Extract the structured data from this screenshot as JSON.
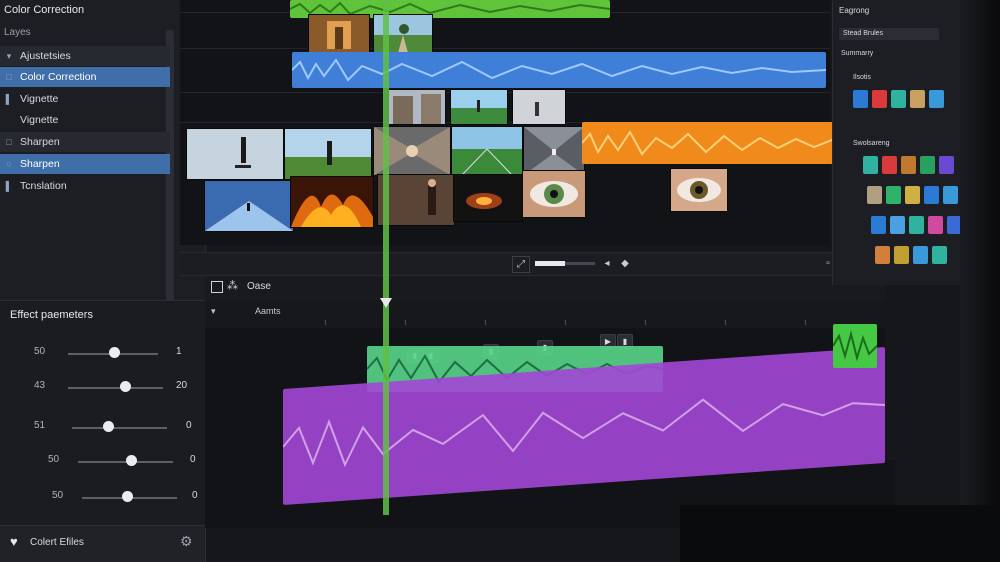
{
  "left_panel": {
    "title": "Color Correction",
    "layer_label": "Layes",
    "items": [
      {
        "label": "Ajustetsies",
        "icon": "collapse-icon",
        "state": "alt"
      },
      {
        "label": "Color Correction",
        "icon": "square-icon",
        "state": "selected"
      },
      {
        "label": "Vignette",
        "icon": "bar-icon",
        "state": "normal"
      },
      {
        "label": "Vignette",
        "icon": "",
        "state": "normal"
      },
      {
        "label": "Sharpen",
        "icon": "square-icon",
        "state": "alt"
      },
      {
        "label": "Sharpen",
        "icon": "circle-icon",
        "state": "selected"
      },
      {
        "label": "Tcnslation",
        "icon": "bar-icon",
        "state": "normal"
      }
    ],
    "effect_parameters": {
      "title": "Effect paemeters",
      "rows": [
        {
          "label": "50",
          "value": "1",
          "level": 0.55
        },
        {
          "label": "43",
          "value": "20",
          "level": 0.62
        },
        {
          "label": "51",
          "value": "0",
          "level": 0.45
        },
        {
          "label": "50",
          "value": "0",
          "level": 0.6
        },
        {
          "label": "50",
          "value": "0",
          "level": 0.55
        }
      ]
    },
    "footer": {
      "label": "Colert Efiles"
    }
  },
  "video_timeline": {
    "clips": [
      {
        "color": "#6fcf3f",
        "kind": "audio"
      },
      {
        "color": "#3f7fd8",
        "kind": "audio"
      },
      {
        "color": "#f08a1a",
        "kind": "audio"
      }
    ],
    "thumbnails": [
      "interior-hallway",
      "park-path",
      "building-street",
      "runner-field",
      "cityscape",
      "skater-snow",
      "skater-grass",
      "tunnel-street",
      "football-field",
      "street-perspective",
      "snow-road",
      "fire-flames",
      "woman-walking",
      "cave-fire",
      "green-eye",
      "brown-eye"
    ]
  },
  "transport": {
    "buttons": [
      "fit-icon",
      "zoom-slider",
      "back-icon",
      "forward-icon"
    ],
    "zoom_level": 0.5
  },
  "audio_header": {
    "label": "Oase",
    "ruler_label": "Aamts",
    "clips": [
      {
        "color": "#57d68a",
        "kind": "audio"
      },
      {
        "color": "#a348d6",
        "kind": "audio"
      },
      {
        "color": "#45c945",
        "kind": "audio"
      }
    ],
    "tool_labels": [
      "▮",
      "▮",
      "▮",
      "▮",
      "▶",
      "▮"
    ]
  },
  "right_panel": {
    "heading": "Eagrong",
    "field_label": "Stead Brules",
    "section1": "Summarry",
    "section2": "Ilsotis",
    "section3": "Swolsareng",
    "swatch_colors_row1": [
      "#2b7bd6",
      "#d93a3a",
      "#2fb3a0",
      "#c8a060",
      "#3a9ad9"
    ],
    "swatch_colors_grid": [
      "#2fb3a0",
      "#d93a3a",
      "#c07a30",
      "#2aa060",
      "#6a4ad0",
      "#b0a080",
      "#2fb36a",
      "#d0b040",
      "#2a7ad6",
      "#3a9ad9",
      "#2b7bd6",
      "#4aa0e0",
      "#2fb3a0",
      "#d04aa0",
      "#3a6ad6",
      "#d0803a",
      "#c0a030",
      "#3a9ad9",
      "#2fb3a0",
      "#d04a80"
    ]
  }
}
